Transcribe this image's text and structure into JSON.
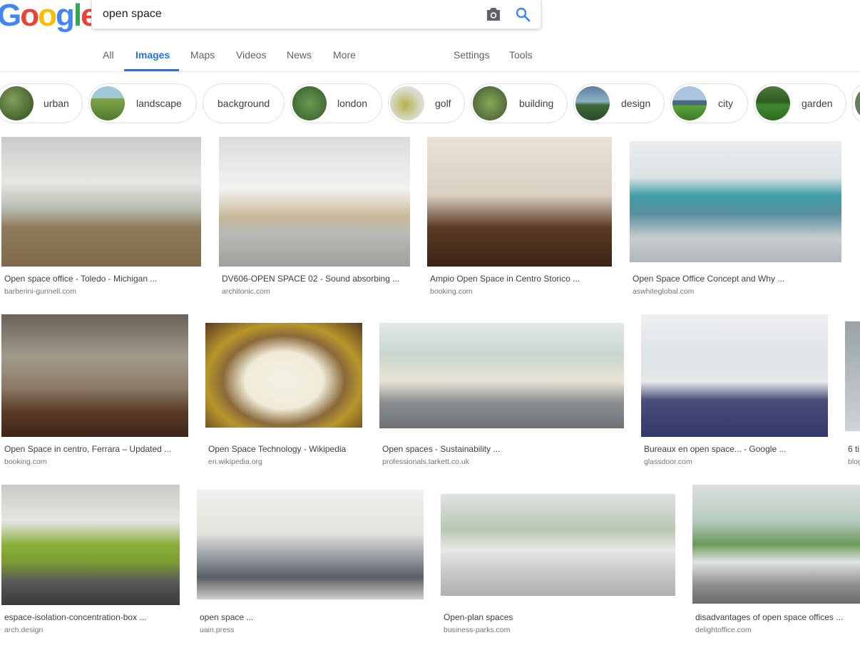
{
  "logo": {
    "letters": [
      "G",
      "o",
      "o",
      "g",
      "l",
      "e"
    ]
  },
  "search": {
    "query": "open space"
  },
  "nav": {
    "tabs": [
      {
        "label": "All"
      },
      {
        "label": "Images"
      },
      {
        "label": "Maps"
      },
      {
        "label": "Videos"
      },
      {
        "label": "News"
      },
      {
        "label": "More"
      }
    ],
    "settings_label": "Settings",
    "tools_label": "Tools",
    "active_tab": "Images"
  },
  "chips": [
    {
      "label": "urban"
    },
    {
      "label": "landscape"
    },
    {
      "label": "background"
    },
    {
      "label": "london"
    },
    {
      "label": "golf"
    },
    {
      "label": "building"
    },
    {
      "label": "design"
    },
    {
      "label": "city"
    },
    {
      "label": "garden"
    }
  ],
  "results": [
    {
      "title": "Open space office - Toledo - Michigan ...",
      "domain": "barberini-gunnell.com"
    },
    {
      "title": "DV606-OPEN SPACE 02 - Sound absorbing ...",
      "domain": "architonic.com"
    },
    {
      "title": "Ampio Open Space in Centro Storico ...",
      "domain": "booking.com"
    },
    {
      "title": "Open Space Office Concept and Why ...",
      "domain": "aswhiteglobal.com"
    },
    {
      "title": "Open Space in centro, Ferrara – Updated ...",
      "domain": "booking.com"
    },
    {
      "title": "Open Space Technology - Wikipedia",
      "domain": "en.wikipedia.org"
    },
    {
      "title": "Open spaces - Sustainability ...",
      "domain": "professionals.tarkett.co.uk"
    },
    {
      "title": "Bureaux en open space... - Google ...",
      "domain": "glassdoor.com"
    },
    {
      "title": "6 ti",
      "domain": "blog"
    },
    {
      "title": "espace-isolation-concentration-box ...",
      "domain": "arch.design"
    },
    {
      "title": "open space ...",
      "domain": "uain.press"
    },
    {
      "title": "Open-plan spaces",
      "domain": "business-parks.com"
    },
    {
      "title": "disadvantages of open space offices ...",
      "domain": "delightoffice.com"
    }
  ],
  "colors": {
    "accent": "#1a73e8",
    "google_blue": "#4285f4",
    "google_red": "#ea4335",
    "google_yellow": "#fbbc05",
    "google_green": "#34a853"
  }
}
